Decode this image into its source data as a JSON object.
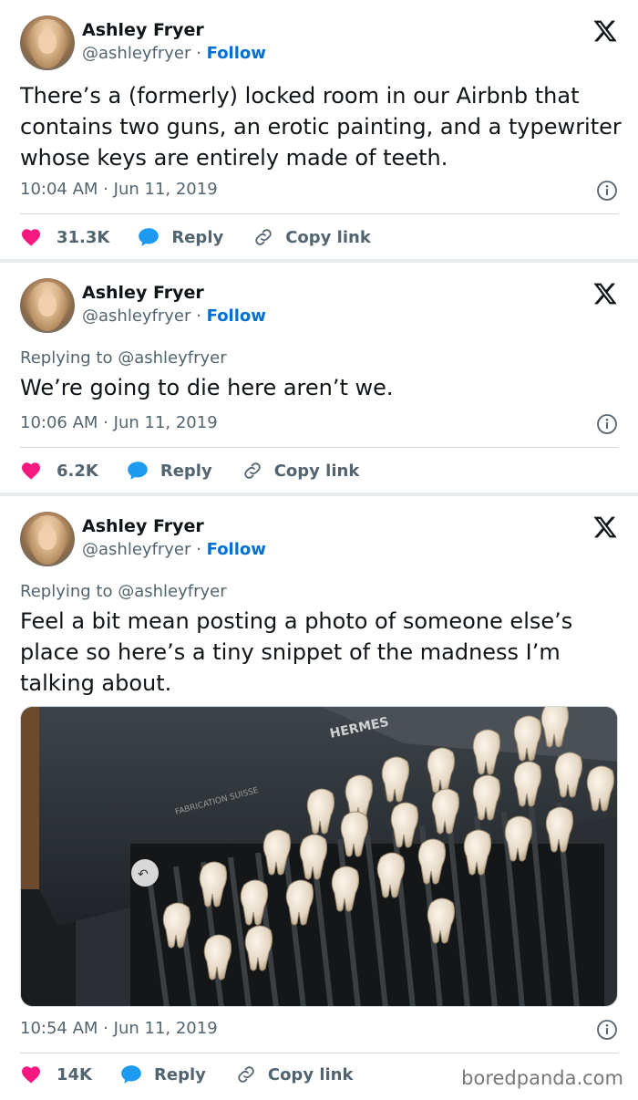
{
  "tweets": [
    {
      "author": {
        "name": "Ashley Fryer",
        "handle": "@ashleyfryer",
        "separator": "·",
        "follow": "Follow"
      },
      "replying_to": null,
      "text": "There’s a (formerly) locked room in our Airbnb that contains two guns, an erotic painting, and a typewriter whose keys are entirely made of teeth.",
      "time": "10:04 AM",
      "date": "Jun 11, 2019",
      "likes": "31.3K",
      "reply_label": "Reply",
      "copy_label": "Copy link"
    },
    {
      "author": {
        "name": "Ashley Fryer",
        "handle": "@ashleyfryer",
        "separator": "·",
        "follow": "Follow"
      },
      "replying_to": "Replying to @ashleyfryer",
      "text": "We’re going to die here aren’t we.",
      "time": "10:06 AM",
      "date": "Jun 11, 2019",
      "likes": "6.2K",
      "reply_label": "Reply",
      "copy_label": "Copy link"
    },
    {
      "author": {
        "name": "Ashley Fryer",
        "handle": "@ashleyfryer",
        "separator": "·",
        "follow": "Follow"
      },
      "replying_to": "Replying to @ashleyfryer",
      "text": "Feel a bit mean posting a photo of someone else’s place so here’s a tiny snippet of the madness I’m talking about.",
      "time": "10:54 AM",
      "date": "Jun 11, 2019",
      "likes": "14K",
      "reply_label": "Reply",
      "copy_label": "Copy link",
      "photo": {
        "brand_text": "HERMES",
        "label_text": "FABRICATION SUISSE"
      }
    }
  ],
  "time_separator": "·",
  "watermark": "boredpanda.com",
  "colors": {
    "like": "#f91880",
    "reply": "#1d9bf0",
    "follow": "#006fd6",
    "secondary": "#536471"
  },
  "icons": [
    "x-logo-icon",
    "info-icon",
    "heart-icon",
    "speech-bubble-icon",
    "link-icon"
  ]
}
